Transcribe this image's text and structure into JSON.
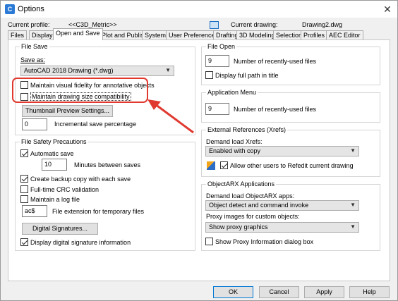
{
  "window": {
    "title": "Options",
    "close_glyph": "✕",
    "app_icon_letter": "C"
  },
  "profile": {
    "label": "Current profile:",
    "value": "<<C3D_Metric>>",
    "drawing_label": "Current drawing:",
    "drawing_value": "Drawing2.dwg"
  },
  "tabs": [
    "Files",
    "Display",
    "Open and Save",
    "Plot and Publish",
    "System",
    "User Preferences",
    "Drafting",
    "3D Modeling",
    "Selection",
    "Profiles",
    "AEC Editor"
  ],
  "active_tab": "Open and Save",
  "file_save": {
    "legend": "File Save",
    "save_as_label": "Save as:",
    "save_as_value": "AutoCAD 2018 Drawing (*.dwg)",
    "cb_visual_fidelity": "Maintain visual fidelity for annotative objects",
    "cb_drawing_size": "Maintain drawing size compatibility",
    "thumbnail_button": "Thumbnail Preview Settings...",
    "incremental_value": "0",
    "incremental_label": "Incremental save percentage"
  },
  "safety": {
    "legend": "File Safety Precautions",
    "autosave_label": "Automatic save",
    "minutes_value": "10",
    "minutes_label": "Minutes between saves",
    "backup_label": "Create backup copy with each save",
    "crc_label": "Full-time CRC validation",
    "log_label": "Maintain a log file",
    "ext_value": "ac$",
    "ext_label": "File extension for temporary files",
    "digsig_button": "Digital Signatures...",
    "digsig_display_label": "Display digital signature information"
  },
  "file_open": {
    "legend": "File Open",
    "recent_value": "9",
    "recent_label": "Number of recently-used files",
    "fullpath_label": "Display full path in title"
  },
  "app_menu": {
    "legend": "Application Menu",
    "recent_value": "9",
    "recent_label": "Number of recently-used files"
  },
  "xrefs": {
    "legend": "External References (Xrefs)",
    "demand_label": "Demand load Xrefs:",
    "demand_value": "Enabled with copy",
    "allow_label": "Allow other users to Refedit current drawing"
  },
  "arx": {
    "legend": "ObjectARX Applications",
    "demand_label": "Demand load ObjectARX apps:",
    "demand_value": "Object detect and command invoke",
    "proxy_label": "Proxy images for custom objects:",
    "proxy_value": "Show proxy graphics",
    "show_proxy_label": "Show Proxy Information dialog box"
  },
  "footer": {
    "ok": "OK",
    "cancel": "Cancel",
    "apply": "Apply",
    "help": "Help"
  },
  "annotation": {
    "highlight_color": "#e03a30"
  }
}
